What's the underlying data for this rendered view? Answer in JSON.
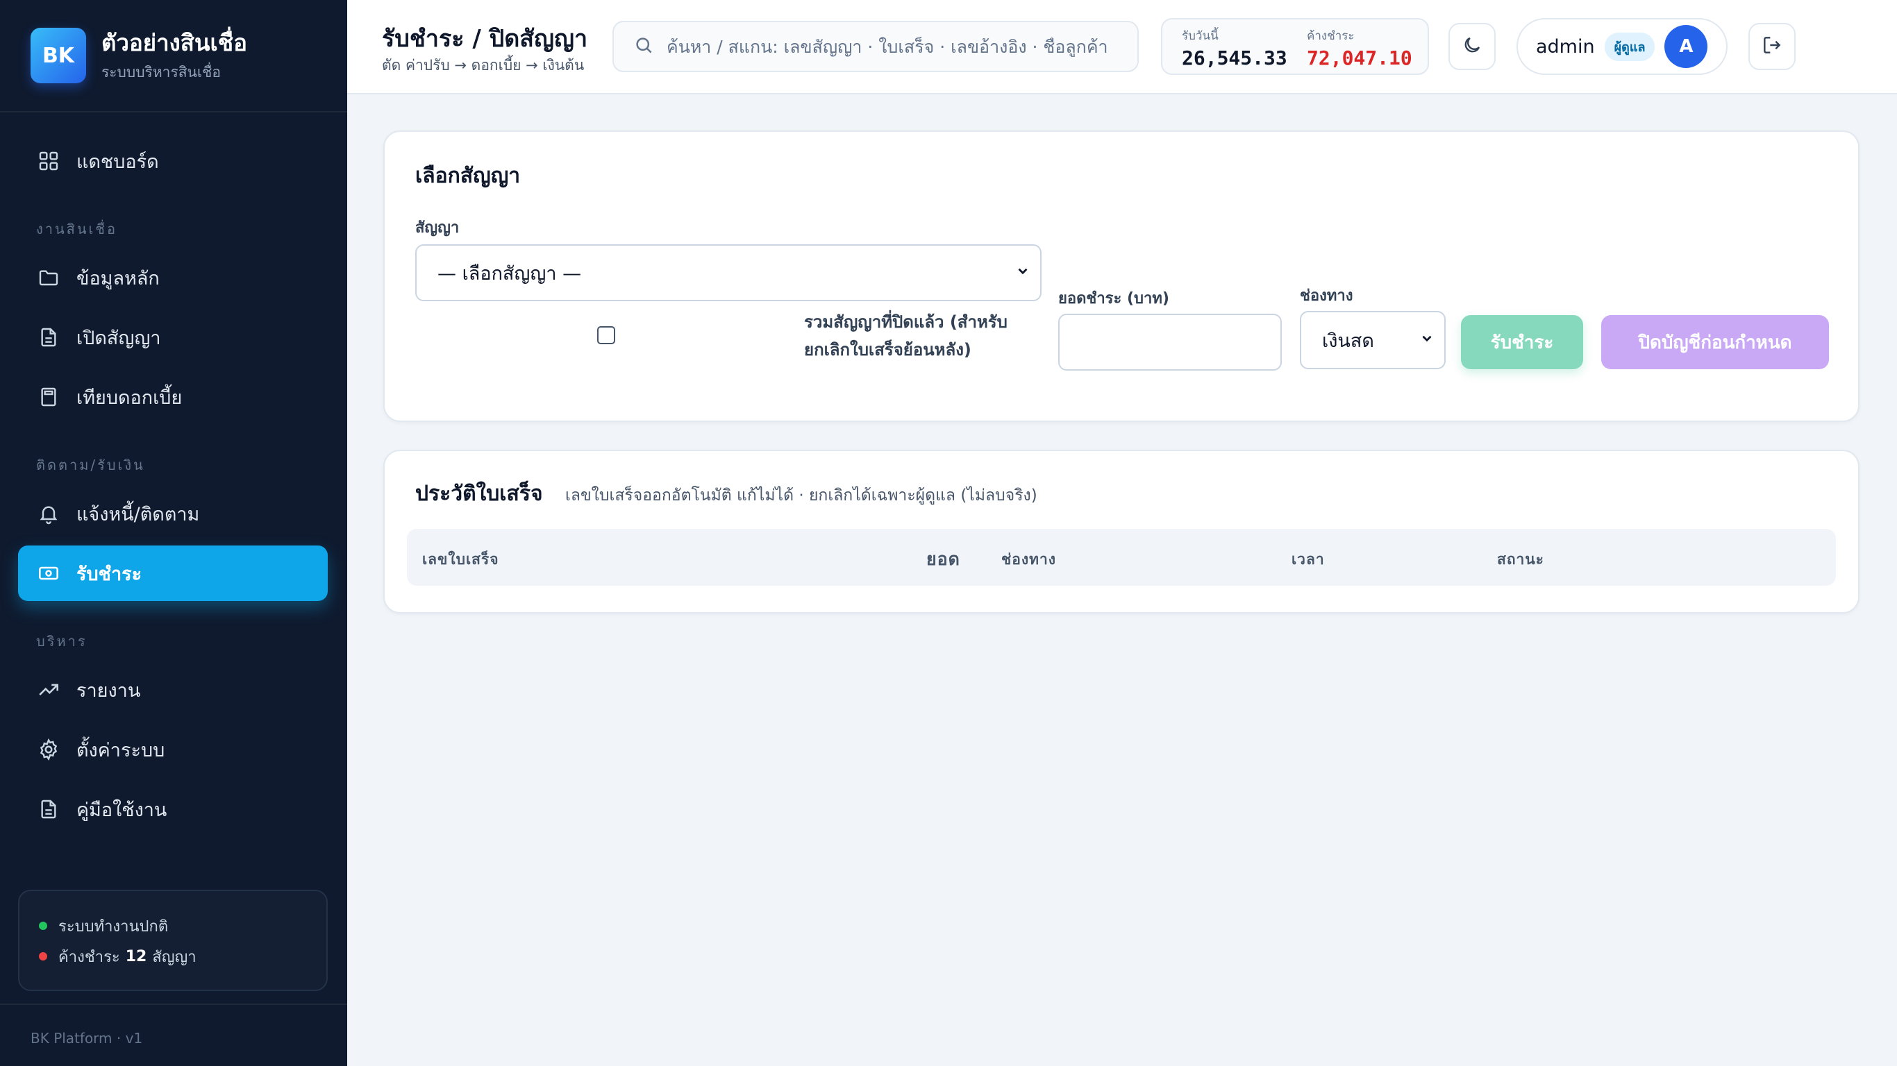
{
  "brand": {
    "logo": "BK",
    "title": "ตัวอย่างสินเชื่อ",
    "subtitle": "ระบบบริหารสินเชื่อ"
  },
  "nav": {
    "dashboard": {
      "label": "แดชบอร์ด",
      "icon": "grid-icon"
    },
    "section_loans": "งานสินเชื่อ",
    "master_data": {
      "label": "ข้อมูลหลัก",
      "icon": "folder-icon"
    },
    "open_contract": {
      "label": "เปิดสัญญา",
      "icon": "file-icon"
    },
    "compare_interest": {
      "label": "เทียบดอกเบี้ย",
      "icon": "calculator-icon"
    },
    "section_collect": "ติดตาม/รับเงิน",
    "notify": {
      "label": "แจ้งหนี้/ติดตาม",
      "icon": "bell-icon"
    },
    "receive_payment": {
      "label": "รับชำระ",
      "icon": "cash-icon",
      "active": true
    },
    "section_admin": "บริหาร",
    "reports": {
      "label": "รายงาน",
      "icon": "trending-up-icon"
    },
    "settings": {
      "label": "ตั้งค่าระบบ",
      "icon": "gear-icon"
    },
    "manual": {
      "label": "คู่มือใช้งาน",
      "icon": "document-icon"
    }
  },
  "system_status": {
    "normal": "ระบบทำงานปกติ",
    "overdue_prefix": "ค้างชำระ",
    "overdue_count": "12",
    "overdue_suffix": "สัญญา",
    "colors": {
      "ok": "#22c55e",
      "alert": "#ef4444"
    }
  },
  "footer": "BK Platform · v1",
  "header": {
    "title": "รับชำระ / ปิดสัญญา",
    "subtitle": "ตัด ค่าปรับ → ดอกเบี้ย → เงินต้น",
    "search_placeholder": "ค้นหา / สแกน: เลขสัญญา · ใบเสร็จ · เลขอ้างอิง · ชื่อลูกค้า",
    "received_today_label": "รับวันนี้",
    "received_today_value": "26,545.33",
    "outstanding_label": "ค้างชำระ",
    "outstanding_value": "72,047.10",
    "user": "admin",
    "role": "ผู้ดูแล",
    "avatar": "A"
  },
  "select_contract": {
    "title": "เลือกสัญญา",
    "contract_label": "สัญญา",
    "contract_value": "— เลือกสัญญา —",
    "include_closed_label": "รวมสัญญาที่ปิดแล้ว (สำหรับยกเลิกใบเสร็จย้อนหลัง)",
    "include_closed_checked": false,
    "amount_label": "ยอดชำระ (บาท)",
    "amount_value": "",
    "channel_label": "ช่องทาง",
    "channel_value": "เงินสด",
    "pay_button": "รับชำระ",
    "close_early_button": "ปิดบัญชีก่อนกำหนด",
    "colors": {
      "pay": "#86d9bc",
      "close_early": "#c9a8f5"
    }
  },
  "receipts": {
    "title": "ประวัติใบเสร็จ",
    "note": "เลขใบเสร็จออกอัตโนมัติ แก้ไม่ได้ · ยกเลิกได้เฉพาะผู้ดูแล (ไม่ลบจริง)",
    "columns": [
      "เลขใบเสร็จ",
      "ยอด",
      "ช่องทาง",
      "เวลา",
      "สถานะ"
    ],
    "rows": []
  }
}
